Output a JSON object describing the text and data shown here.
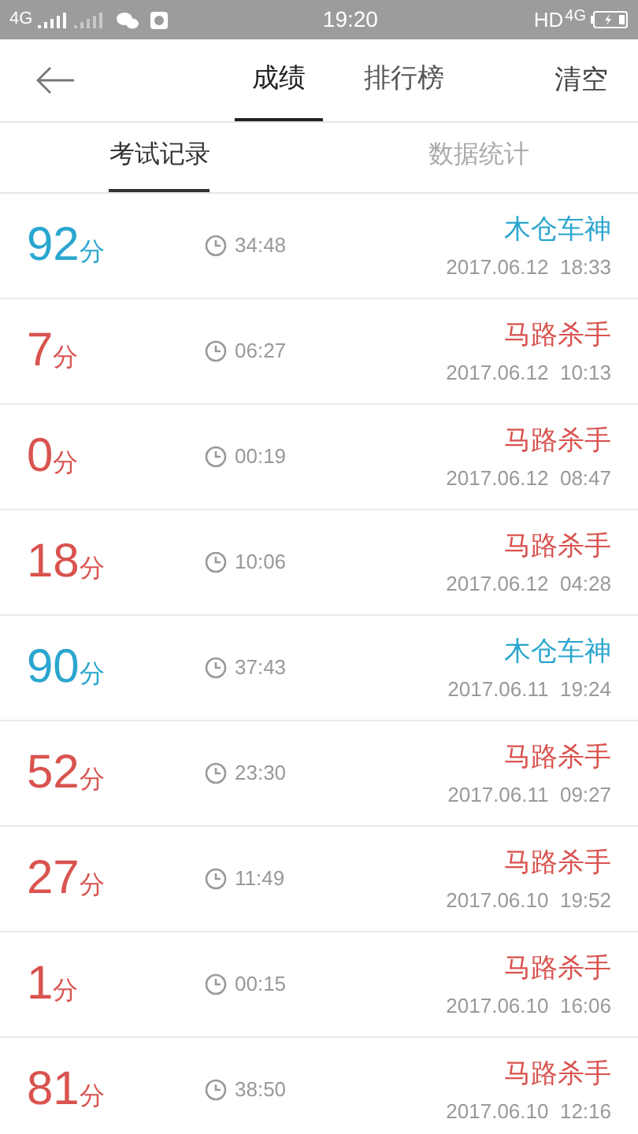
{
  "status_bar": {
    "network": "4G",
    "time": "19:20",
    "hd": "HD",
    "network_right": "4G"
  },
  "header": {
    "tabs": [
      {
        "label": "成绩",
        "selected": true
      },
      {
        "label": "排行榜",
        "selected": false
      }
    ],
    "action": "清空"
  },
  "sub_tabs": [
    {
      "label": "考试记录",
      "selected": true
    },
    {
      "label": "数据统计",
      "selected": false
    }
  ],
  "records": [
    {
      "score": "92",
      "unit": "分",
      "duration": "34:48",
      "title": "木仓车神",
      "date": "2017.06.12  18:33",
      "color": "#2aa6cf"
    },
    {
      "score": "7",
      "unit": "分",
      "duration": "06:27",
      "title": "马路杀手",
      "date": "2017.06.12  10:13",
      "color": "#d9534f"
    },
    {
      "score": "0",
      "unit": "分",
      "duration": "00:19",
      "title": "马路杀手",
      "date": "2017.06.12  08:47",
      "color": "#d9534f"
    },
    {
      "score": "18",
      "unit": "分",
      "duration": "10:06",
      "title": "马路杀手",
      "date": "2017.06.12  04:28",
      "color": "#d9534f"
    },
    {
      "score": "90",
      "unit": "分",
      "duration": "37:43",
      "title": "木仓车神",
      "date": "2017.06.11  19:24",
      "color": "#2aa6cf"
    },
    {
      "score": "52",
      "unit": "分",
      "duration": "23:30",
      "title": "马路杀手",
      "date": "2017.06.11  09:27",
      "color": "#d9534f"
    },
    {
      "score": "27",
      "unit": "分",
      "duration": "11:49",
      "title": "马路杀手",
      "date": "2017.06.10  19:52",
      "color": "#d9534f"
    },
    {
      "score": "1",
      "unit": "分",
      "duration": "00:15",
      "title": "马路杀手",
      "date": "2017.06.10  16:06",
      "color": "#d9534f"
    },
    {
      "score": "81",
      "unit": "分",
      "duration": "38:50",
      "title": "马路杀手",
      "date": "2017.06.10  12:16",
      "color": "#d9534f"
    }
  ]
}
